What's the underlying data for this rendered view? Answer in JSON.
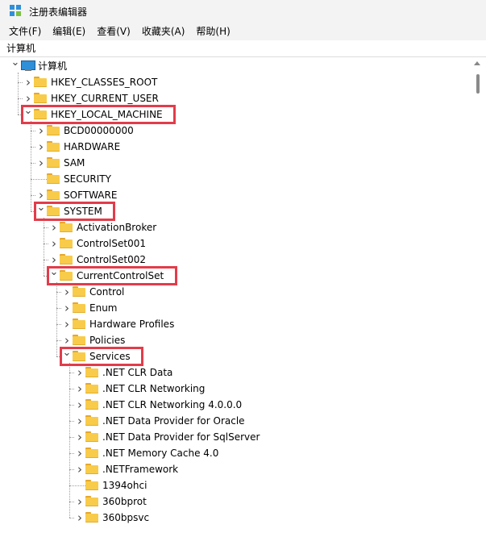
{
  "window": {
    "title": "注册表编辑器"
  },
  "menu": [
    "文件(F)",
    "编辑(E)",
    "查看(V)",
    "收藏夹(A)",
    "帮助(H)"
  ],
  "address": "计算机",
  "tree": [
    {
      "label": "计算机",
      "level": 0,
      "state": "expanded",
      "icon": "computer-icon"
    },
    {
      "label": "HKEY_CLASSES_ROOT",
      "level": 1,
      "state": "collapsed",
      "icon": "folder-icon"
    },
    {
      "label": "HKEY_CURRENT_USER",
      "level": 1,
      "state": "collapsed",
      "icon": "folder-icon"
    },
    {
      "label": "HKEY_LOCAL_MACHINE",
      "level": 1,
      "state": "expanded",
      "icon": "folder-icon",
      "highlighted": true
    },
    {
      "label": "BCD00000000",
      "level": 2,
      "state": "collapsed",
      "icon": "folder-icon"
    },
    {
      "label": "HARDWARE",
      "level": 2,
      "state": "collapsed",
      "icon": "folder-icon"
    },
    {
      "label": "SAM",
      "level": 2,
      "state": "collapsed",
      "icon": "folder-icon"
    },
    {
      "label": "SECURITY",
      "level": 2,
      "state": "leaf",
      "icon": "folder-icon"
    },
    {
      "label": "SOFTWARE",
      "level": 2,
      "state": "collapsed",
      "icon": "folder-icon"
    },
    {
      "label": "SYSTEM",
      "level": 2,
      "state": "expanded",
      "icon": "folder-icon",
      "highlighted": true
    },
    {
      "label": "ActivationBroker",
      "level": 3,
      "state": "collapsed",
      "icon": "folder-icon"
    },
    {
      "label": "ControlSet001",
      "level": 3,
      "state": "collapsed",
      "icon": "folder-icon"
    },
    {
      "label": "ControlSet002",
      "level": 3,
      "state": "collapsed",
      "icon": "folder-icon"
    },
    {
      "label": "CurrentControlSet",
      "level": 3,
      "state": "expanded",
      "icon": "folder-icon",
      "highlighted": true
    },
    {
      "label": "Control",
      "level": 4,
      "state": "collapsed",
      "icon": "folder-icon"
    },
    {
      "label": "Enum",
      "level": 4,
      "state": "collapsed",
      "icon": "folder-icon"
    },
    {
      "label": "Hardware Profiles",
      "level": 4,
      "state": "collapsed",
      "icon": "folder-icon"
    },
    {
      "label": "Policies",
      "level": 4,
      "state": "collapsed",
      "icon": "folder-icon"
    },
    {
      "label": "Services",
      "level": 4,
      "state": "expanded",
      "icon": "folder-icon",
      "highlighted": true
    },
    {
      "label": ".NET CLR Data",
      "level": 5,
      "state": "collapsed",
      "icon": "folder-icon"
    },
    {
      "label": ".NET CLR Networking",
      "level": 5,
      "state": "collapsed",
      "icon": "folder-icon"
    },
    {
      "label": ".NET CLR Networking 4.0.0.0",
      "level": 5,
      "state": "collapsed",
      "icon": "folder-icon"
    },
    {
      "label": ".NET Data Provider for Oracle",
      "level": 5,
      "state": "collapsed",
      "icon": "folder-icon"
    },
    {
      "label": ".NET Data Provider for SqlServer",
      "level": 5,
      "state": "collapsed",
      "icon": "folder-icon"
    },
    {
      "label": ".NET Memory Cache 4.0",
      "level": 5,
      "state": "collapsed",
      "icon": "folder-icon"
    },
    {
      "label": ".NETFramework",
      "level": 5,
      "state": "collapsed",
      "icon": "folder-icon"
    },
    {
      "label": "1394ohci",
      "level": 5,
      "state": "leaf",
      "icon": "folder-icon"
    },
    {
      "label": "360bprot",
      "level": 5,
      "state": "collapsed",
      "icon": "folder-icon"
    },
    {
      "label": "360bpsvc",
      "level": 5,
      "state": "collapsed",
      "icon": "folder-icon"
    }
  ],
  "colors": {
    "highlight_border": "#e23c4a",
    "folder": "#f8cc4a",
    "chrome": "#f3f3f3"
  }
}
